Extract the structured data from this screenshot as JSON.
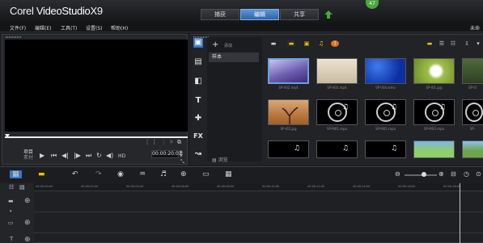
{
  "app": {
    "brand": "Corel",
    "product": "VideoStudio",
    "version": "X9"
  },
  "tabs": [
    "捕获",
    "编辑",
    "共享"
  ],
  "active_tab": "编辑",
  "badge": "47",
  "menu": [
    "文件(F)",
    "编辑(E)",
    "工具(T)",
    "设置(S)",
    "帮助(H)"
  ],
  "menu_right": "未命",
  "preview": {
    "mode_label": "项目\n素材",
    "play_controls": [
      "▶",
      "⏮",
      "◀|",
      "|▶",
      "⏭",
      "↻",
      "◀)",
      "HD"
    ],
    "timecode": "00:00:20:01"
  },
  "library": {
    "add_label": "添加",
    "folder": "样本",
    "browse_label": "浏览",
    "items": [
      {
        "caption": "SP-V02.mp4",
        "kind": "video",
        "style": "purple"
      },
      {
        "caption": "SP-V03.mp4",
        "kind": "video",
        "style": "beige"
      },
      {
        "caption": "SP-V04.wmv",
        "kind": "video",
        "style": "blue",
        "selected": true
      },
      {
        "caption": "SP-I01.jpg",
        "kind": "image",
        "style": "dandelion"
      },
      {
        "caption": "SP-I0",
        "kind": "image",
        "style": "partial"
      },
      {
        "caption": "SP-I02.jpg",
        "kind": "image",
        "style": "tree"
      },
      {
        "caption": "SP-M01.mpa",
        "kind": "audio"
      },
      {
        "caption": "SP-M02.mpa",
        "kind": "audio"
      },
      {
        "caption": "SP-M03.mpa",
        "kind": "audio"
      },
      {
        "caption": "SP-",
        "kind": "audio"
      }
    ]
  },
  "timeline": {
    "ticks": [
      "00:00:00:00",
      "00:00:02:00",
      "00:00:04:00",
      "00:00:06:00",
      "00:00:08:00",
      "00:00:10:00",
      "00:00:12:00",
      "00:00:14:00",
      "00:00:16:00",
      "00:00:18:00"
    ]
  },
  "colors": {
    "accent": "#3a78c4",
    "badge": "#4ea63f",
    "background": "#1e1f22"
  }
}
